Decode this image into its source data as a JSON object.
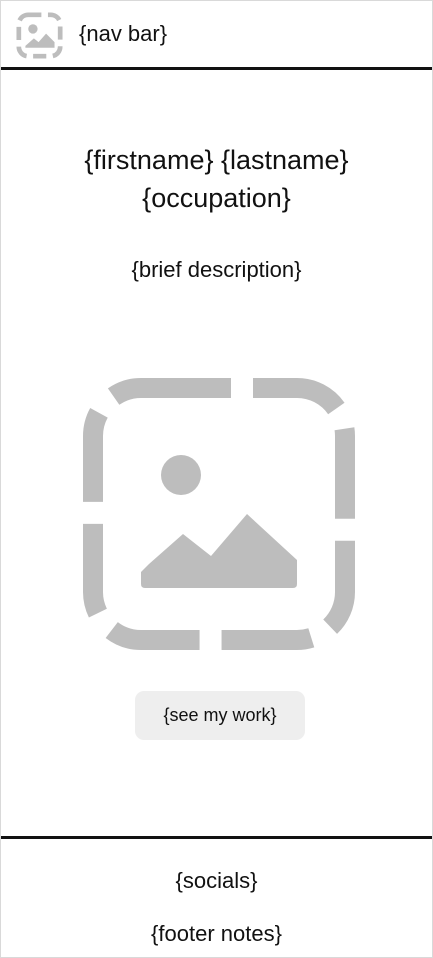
{
  "nav": {
    "title": "{nav bar}",
    "icon": "image-placeholder-icon"
  },
  "hero": {
    "name": "{firstname} {lastname}",
    "occupation": "{occupation}",
    "description": "{brief description}",
    "image_icon": "image-placeholder-icon",
    "cta_label": "{see my work}"
  },
  "footer": {
    "socials": "{socials}",
    "notes": "{footer notes}"
  },
  "colors": {
    "placeholder": "#bdbdbd",
    "button_bg": "#eeeeee",
    "divider": "#111111"
  }
}
